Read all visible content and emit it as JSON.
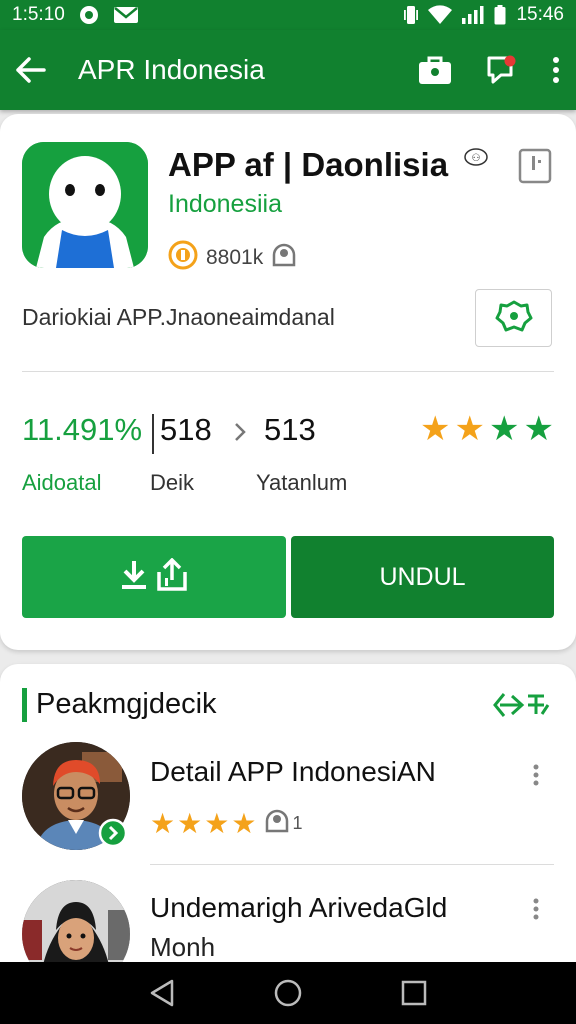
{
  "status": {
    "time_left": "1:5:10",
    "time_right": "15:46"
  },
  "appbar": {
    "title": "APR Indonesia"
  },
  "app": {
    "name": "APP af | Daonlisia",
    "subtitle": "Indonesiia",
    "meta_text": "8801k",
    "description": "Dariokiai APP.Jnaoneaimdanal"
  },
  "stats": [
    {
      "value": "11.491%",
      "label": "Aidoatal",
      "color": "#16a03f"
    },
    {
      "value": "518",
      "label": "Deik",
      "color": "#111111"
    },
    {
      "value": "513",
      "label": "Yatanlum",
      "color": "#111111"
    }
  ],
  "rating": {
    "stars_orange": 2,
    "stars_green": 2
  },
  "buttons": {
    "primary_label": "UNDUL"
  },
  "reviews_section": {
    "title": "Peakmgjdecik",
    "items": [
      {
        "name": "Detail APP IndonesiAN",
        "rating": 4,
        "helpful_count": "1"
      },
      {
        "name": "Undemarigh ArivedaGld",
        "sub": "Monh"
      }
    ]
  },
  "colors": {
    "primary": "#11812f",
    "accent": "#16a03f",
    "star_orange": "#f4a21a"
  }
}
